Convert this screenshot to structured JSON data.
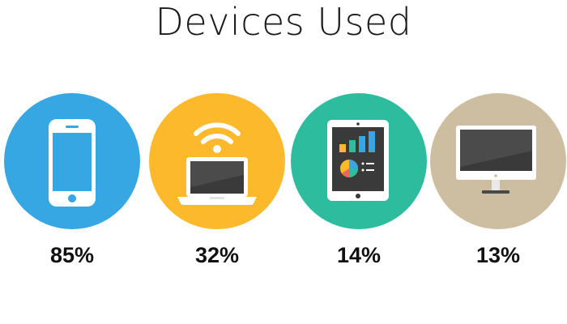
{
  "chart_data": {
    "type": "bar",
    "title": "Devices Used",
    "categories": [
      "smartphone",
      "laptop",
      "tablet",
      "desktop"
    ],
    "values": [
      85,
      32,
      14,
      13
    ],
    "labels": [
      "85%",
      "32%",
      "14%",
      "13%"
    ],
    "unit": "%",
    "colors": [
      "#36a7e2",
      "#fcb92c",
      "#2dbd9e",
      "#cdbea2"
    ],
    "icons": [
      "smartphone-icon",
      "laptop-wifi-icon",
      "tablet-chart-icon",
      "desktop-monitor-icon"
    ]
  }
}
